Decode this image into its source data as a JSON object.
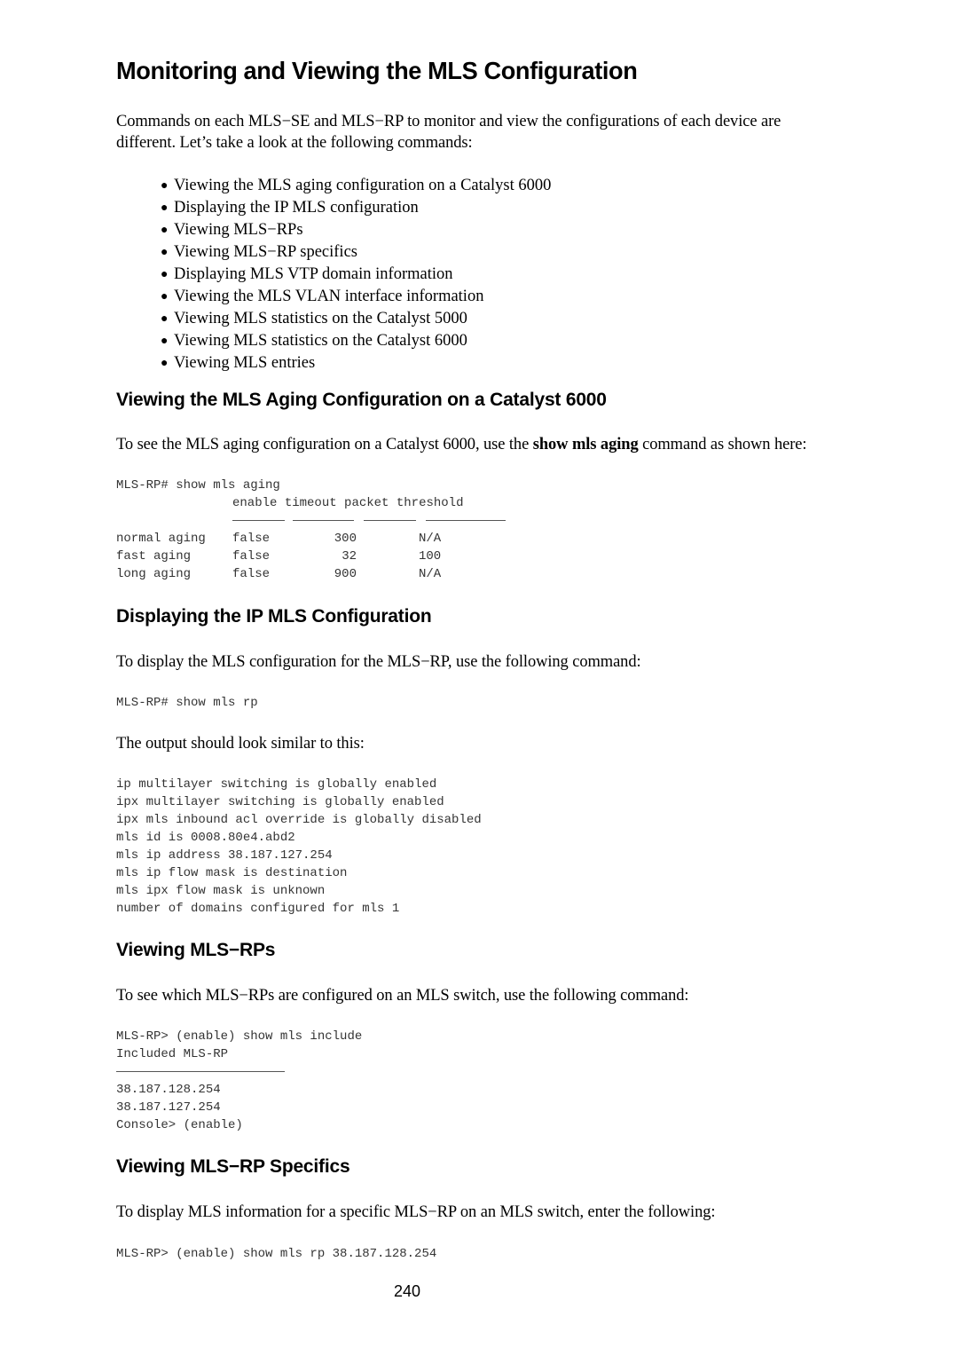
{
  "title": "Monitoring and Viewing the MLS Configuration",
  "intro": {
    "line1": "Commands on each MLS−SE and MLS−RP to monitor and view the configurations of each device are",
    "line2": "different. Let’s take a look at the following commands:"
  },
  "bullets": [
    "Viewing the MLS aging configuration on a Catalyst 6000",
    "Displaying the IP MLS configuration",
    "Viewing MLS−RPs",
    "Viewing MLS−RP specifics",
    "Displaying MLS VTP domain information",
    "Viewing the MLS VLAN interface information",
    "Viewing MLS statistics on the Catalyst 5000",
    "Viewing MLS statistics on the Catalyst 6000",
    "Viewing MLS entries"
  ],
  "sections": {
    "aging": {
      "heading": "Viewing the MLS Aging Configuration on a Catalyst 6000",
      "text_before": "To see the MLS aging configuration on a Catalyst 6000, use the ",
      "text_bold": "show mls aging",
      "text_after": " command as shown here:",
      "command": "MLS-RP# show mls aging",
      "table_headers": [
        "enable",
        "timeout",
        "packet",
        "threshold"
      ],
      "table_rows": [
        {
          "name": "normal aging",
          "enable": "false",
          "timeout": "300",
          "threshold": "N/A"
        },
        {
          "name": "fast aging",
          "enable": "false",
          "timeout": "32",
          "threshold": "100"
        },
        {
          "name": "long aging",
          "enable": "false",
          "timeout": "900",
          "threshold": "N/A"
        }
      ]
    },
    "ip_mls": {
      "heading": "Displaying the IP MLS Configuration",
      "text": "To display the MLS configuration for the MLS−RP, use the following command:",
      "command": "MLS-RP# show mls rp",
      "text2": "The output should look similar to this:",
      "output": [
        "ip multilayer switching is globally enabled",
        "ipx multilayer switching is globally enabled",
        "ipx mls inbound acl override is globally disabled",
        "mls id is 0008.80e4.abd2",
        "mls ip address 38.187.127.254",
        "mls ip flow mask is destination",
        "mls ipx flow mask is unknown",
        "number of domains configured for mls 1"
      ]
    },
    "rps": {
      "heading": "Viewing MLS−RPs",
      "text": "To see which MLS−RPs are configured on an MLS switch, use the following command:",
      "command": "MLS-RP> (enable) show mls include",
      "header": "Included MLS-RP",
      "output": [
        "38.187.128.254",
        "38.187.127.254",
        "Console> (enable)"
      ]
    },
    "rp_specifics": {
      "heading": "Viewing MLS−RP Specifics",
      "text": "To display MLS information for a specific MLS−RP on an MLS switch, enter the following:",
      "command": "MLS-RP> (enable) show mls rp 38.187.128.254"
    }
  },
  "page_number": "240"
}
